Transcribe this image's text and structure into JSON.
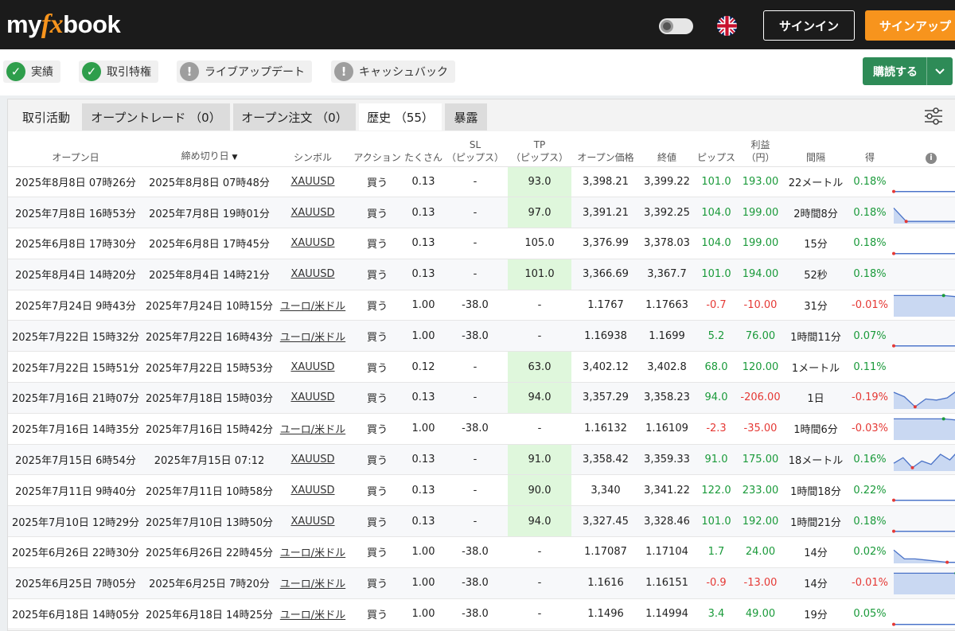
{
  "header": {
    "logo_my": "my",
    "logo_fx": "fx",
    "logo_book": "book",
    "signin_label": "サインイン",
    "signup_label": "サインアップ"
  },
  "badges": [
    {
      "label": "実績",
      "icon": "check-circle-icon",
      "status": "ok"
    },
    {
      "label": "取引特権",
      "icon": "check-circle-icon",
      "status": "ok"
    },
    {
      "label": "ライブアップデート",
      "icon": "exclamation-circle-icon",
      "status": "warn"
    },
    {
      "label": "キャッシュバック",
      "icon": "exclamation-circle-icon",
      "status": "warn"
    }
  ],
  "subscribe_label": "購読する",
  "tabs": [
    {
      "label": "取引活動"
    },
    {
      "label": "オープントレード （0）"
    },
    {
      "label": "オープン注文 （0）"
    },
    {
      "label": "歴史 （55）"
    },
    {
      "label": "暴露"
    }
  ],
  "columns": {
    "open_date": "オープン日",
    "close_date": "締め切り日",
    "symbol": "シンボル",
    "action": "アクション",
    "lots": "たくさん",
    "sl_1": "SL",
    "sl_2": "（ピップス）",
    "tp_1": "TP",
    "tp_2": "（ピップス）",
    "open_price": "オープン価格",
    "close_price": "終値",
    "pips": "ピップス",
    "profit_1": "利益",
    "profit_2": "（円）",
    "duration": "間隔",
    "gain": "得",
    "info": "i"
  },
  "rows": [
    {
      "open": "2025年8月8日 07時26分",
      "close": "2025年8月8日 07時48分",
      "symbol": "XAUUSD",
      "action": "買う",
      "lots": "0.13",
      "sl": "-",
      "tp": "93.0",
      "tp_hl": true,
      "open_price": "3,398.21",
      "close_price": "3,399.22",
      "pips": "101.0",
      "profit": "193.00",
      "duration": "22メートル",
      "gain": "0.18%",
      "positive": true,
      "spark": [
        0.05,
        0.05,
        0.05,
        0.05,
        0.05,
        0.05,
        0.95
      ]
    },
    {
      "open": "2025年7月8日 16時53分",
      "close": "2025年7月8日 19時01分",
      "symbol": "XAUUSD",
      "action": "買う",
      "lots": "0.13",
      "sl": "-",
      "tp": "97.0",
      "tp_hl": true,
      "open_price": "3,391.21",
      "close_price": "3,392.25",
      "pips": "104.0",
      "profit": "199.00",
      "duration": "2時間8分",
      "gain": "0.18%",
      "positive": true,
      "spark": [
        0.7,
        0.1,
        0.1,
        0.1,
        0.1,
        0.1,
        0.95
      ]
    },
    {
      "open": "2025年6月8日 17時30分",
      "close": "2025年6月8日 17時45分",
      "symbol": "XAUUSD",
      "action": "買う",
      "lots": "0.13",
      "sl": "-",
      "tp": "105.0",
      "tp_hl": false,
      "open_price": "3,376.99",
      "close_price": "3,378.03",
      "pips": "104.0",
      "profit": "199.00",
      "duration": "15分",
      "gain": "0.18%",
      "positive": true,
      "spark": [
        0.05,
        0.05,
        0.05,
        0.05,
        0.05,
        0.05,
        0.95
      ]
    },
    {
      "open": "2025年8月4日 14時20分",
      "close": "2025年8月4日 14時21分",
      "symbol": "XAUUSD",
      "action": "買う",
      "lots": "0.13",
      "sl": "-",
      "tp": "101.0",
      "tp_hl": true,
      "open_price": "3,366.69",
      "close_price": "3,367.7",
      "pips": "101.0",
      "profit": "194.00",
      "duration": "52秒",
      "gain": "0.18%",
      "positive": true,
      "spark": []
    },
    {
      "open": "2025年7月24日 9時43分",
      "close": "2025年7月24日 10時15分",
      "symbol": "ユーロ/米ドル",
      "action": "買う",
      "lots": "1.00",
      "sl": "-38.0",
      "tp": "-",
      "tp_hl": false,
      "open_price": "1.1767",
      "close_price": "1.17663",
      "pips": "-0.7",
      "profit": "-10.00",
      "duration": "31分",
      "gain": "-0.01%",
      "positive": false,
      "spark": [
        0.95,
        0.95,
        0.95,
        0.95,
        0.95,
        0.9,
        0.05
      ]
    },
    {
      "open": "2025年7月22日 15時32分",
      "close": "2025年7月22日 16時43分",
      "symbol": "ユーロ/米ドル",
      "action": "買う",
      "lots": "1.00",
      "sl": "-38.0",
      "tp": "-",
      "tp_hl": false,
      "open_price": "1.16938",
      "close_price": "1.1699",
      "pips": "5.2",
      "profit": "76.00",
      "duration": "1時間11分",
      "gain": "0.07%",
      "positive": true,
      "spark": [
        0.05,
        0.05,
        0.05,
        0.05,
        0.05,
        0.05,
        0.95
      ]
    },
    {
      "open": "2025年7月22日 15時51分",
      "close": "2025年7月22日 15時53分",
      "symbol": "XAUUSD",
      "action": "買う",
      "lots": "0.12",
      "sl": "-",
      "tp": "63.0",
      "tp_hl": true,
      "open_price": "3,402.12",
      "close_price": "3,402.8",
      "pips": "68.0",
      "profit": "120.00",
      "duration": "1メートル",
      "gain": "0.11%",
      "positive": true,
      "spark": []
    },
    {
      "open": "2025年7月16日 21時07分",
      "close": "2025年7月18日 15時03分",
      "symbol": "XAUUSD",
      "action": "買う",
      "lots": "0.13",
      "sl": "-",
      "tp": "94.0",
      "tp_hl": true,
      "open_price": "3,357.29",
      "close_price": "3,358.23",
      "pips": "94.0",
      "profit": "-206.00",
      "duration": "1日",
      "gain": "-0.19%",
      "positive": false,
      "spark": [
        0.75,
        0.55,
        0.1,
        0.45,
        0.4,
        0.5,
        0.85,
        0.8
      ]
    },
    {
      "open": "2025年7月16日 14時35分",
      "close": "2025年7月16日 15時42分",
      "symbol": "ユーロ/米ドル",
      "action": "買う",
      "lots": "1.00",
      "sl": "-38.0",
      "tp": "-",
      "tp_hl": false,
      "open_price": "1.16132",
      "close_price": "1.16109",
      "pips": "-2.3",
      "profit": "-35.00",
      "duration": "1時間6分",
      "gain": "-0.03%",
      "positive": false,
      "spark": [
        0.95,
        0.95,
        0.95,
        0.95,
        0.95,
        0.9,
        0.05
      ]
    },
    {
      "open": "2025年7月15日 6時54分",
      "close": "2025年7月15日 07:12",
      "symbol": "XAUUSD",
      "action": "買う",
      "lots": "0.13",
      "sl": "-",
      "tp": "91.0",
      "tp_hl": true,
      "open_price": "3,358.42",
      "close_price": "3,359.33",
      "pips": "91.0",
      "profit": "175.00",
      "duration": "18メートル",
      "gain": "0.16%",
      "positive": true,
      "spark": [
        0.35,
        0.6,
        0.15,
        0.45,
        0.3,
        0.75,
        0.5,
        0.95,
        0.65
      ]
    },
    {
      "open": "2025年7月11日 9時40分",
      "close": "2025年7月11日 10時58分",
      "symbol": "XAUUSD",
      "action": "買う",
      "lots": "0.13",
      "sl": "-",
      "tp": "90.0",
      "tp_hl": true,
      "open_price": "3,340",
      "close_price": "3,341.22",
      "pips": "122.0",
      "profit": "233.00",
      "duration": "1時間18分",
      "gain": "0.22%",
      "positive": true,
      "spark": [
        0.05,
        0.05,
        0.05,
        0.05,
        0.05,
        0.05,
        0.95
      ]
    },
    {
      "open": "2025年7月10日 12時29分",
      "close": "2025年7月10日 13時50分",
      "symbol": "XAUUSD",
      "action": "買う",
      "lots": "0.13",
      "sl": "-",
      "tp": "94.0",
      "tp_hl": true,
      "open_price": "3,327.45",
      "close_price": "3,328.46",
      "pips": "101.0",
      "profit": "192.00",
      "duration": "1時間21分",
      "gain": "0.18%",
      "positive": true,
      "spark": [
        0.05,
        0.05,
        0.05,
        0.05,
        0.05,
        0.05,
        0.95
      ]
    },
    {
      "open": "2025年6月26日 22時30分",
      "close": "2025年6月26日 22時45分",
      "symbol": "ユーロ/米ドル",
      "action": "買う",
      "lots": "1.00",
      "sl": "-38.0",
      "tp": "-",
      "tp_hl": false,
      "open_price": "1.17087",
      "close_price": "1.17104",
      "pips": "1.7",
      "profit": "24.00",
      "duration": "14分",
      "gain": "0.02%",
      "positive": true,
      "spark": [
        0.6,
        0.2,
        0.2,
        0.15,
        0.1,
        0.05,
        0.05,
        0.95
      ]
    },
    {
      "open": "2025年6月25日 7時05分",
      "close": "2025年6月25日 7時20分",
      "symbol": "ユーロ/米ドル",
      "action": "買う",
      "lots": "1.00",
      "sl": "-38.0",
      "tp": "-",
      "tp_hl": false,
      "open_price": "1.1616",
      "close_price": "1.16151",
      "pips": "-0.9",
      "profit": "-13.00",
      "duration": "14分",
      "gain": "-0.01%",
      "positive": false,
      "spark": [
        0.95,
        0.95,
        0.95,
        0.95,
        0.95,
        0.95,
        0.05
      ]
    },
    {
      "open": "2025年6月18日 14時05分",
      "close": "2025年6月18日 14時25分",
      "symbol": "ユーロ/米ドル",
      "action": "買う",
      "lots": "1.00",
      "sl": "-38.0",
      "tp": "-",
      "tp_hl": false,
      "open_price": "1.1496",
      "close_price": "1.14994",
      "pips": "3.4",
      "profit": "49.00",
      "duration": "19分",
      "gain": "0.05%",
      "positive": true,
      "spark": [
        0.05,
        0.05,
        0.05,
        0.05,
        0.05,
        0.05,
        0.95
      ]
    }
  ],
  "colors": {
    "accent_orange": "#f7941d",
    "subscribe_green": "#2e8b57",
    "positive_green": "#1a9a3a",
    "negative_red": "#e53935",
    "tp_highlight": "#dff7dc"
  }
}
